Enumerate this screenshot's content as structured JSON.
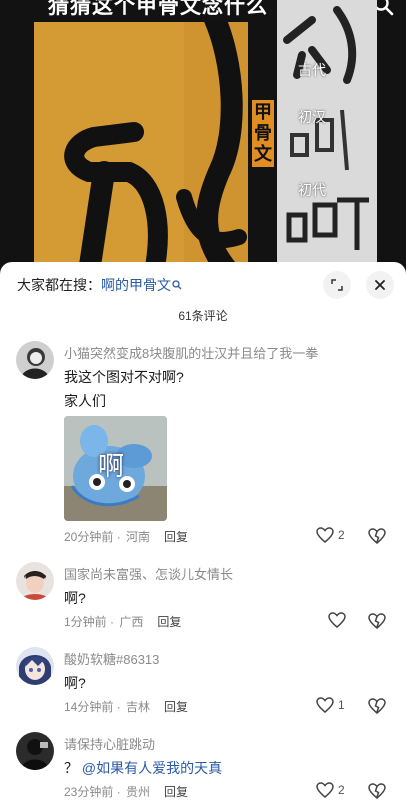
{
  "video": {
    "title": "猜猜这个甲骨文念什么",
    "vertical_label": [
      "甲",
      "骨",
      "文"
    ],
    "eras": [
      "古代",
      "初汉",
      "初代"
    ]
  },
  "sheet": {
    "searching_prefix": "大家都在搜：",
    "searching_keyword": "啊的甲骨文",
    "comment_count": "61条评论"
  },
  "comments": [
    {
      "username": "小猫突然变成8块腹肌的壮汉并且给了我一拳",
      "lines": [
        "我这个图对不对啊?",
        "家人们"
      ],
      "image_text": "啊",
      "time": "20分钟前",
      "location": "河南",
      "reply": "回复",
      "likes": "2"
    },
    {
      "username": "国家尚未富强、怎谈儿女情长",
      "lines": [
        "啊?"
      ],
      "time": "1分钟前",
      "location": "广西",
      "reply": "回复",
      "likes": ""
    },
    {
      "username": "酸奶软糖#86313",
      "lines": [
        "啊?"
      ],
      "time": "14分钟前",
      "location": "吉林",
      "reply": "回复",
      "likes": "1"
    },
    {
      "username": "请保持心脏跳动",
      "text_prefix": "？",
      "mention": "@如果有人爱我的天真",
      "time": "23分钟前",
      "location": "贵州",
      "reply": "回复",
      "likes": "2"
    }
  ],
  "colors": {
    "accent_link": "#2b5aa6",
    "meta_gray": "#8a8a8a",
    "panel_orange": "#d79a2c"
  },
  "icons": [
    "search-icon",
    "expand-icon",
    "close-icon",
    "heart-icon",
    "dislike-heart-icon"
  ]
}
